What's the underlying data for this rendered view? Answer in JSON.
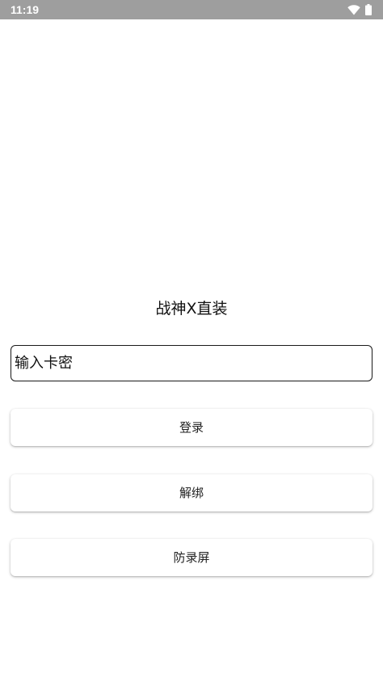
{
  "status_bar": {
    "time": "11:19",
    "icons": [
      "wifi-icon",
      "battery-icon"
    ],
    "background": "#9e9e9e"
  },
  "app": {
    "title": "战神X直装"
  },
  "card_input": {
    "placeholder": "输入卡密",
    "value": ""
  },
  "buttons": {
    "login": "登录",
    "unbind": "解绑",
    "anti_record": "防录屏"
  }
}
